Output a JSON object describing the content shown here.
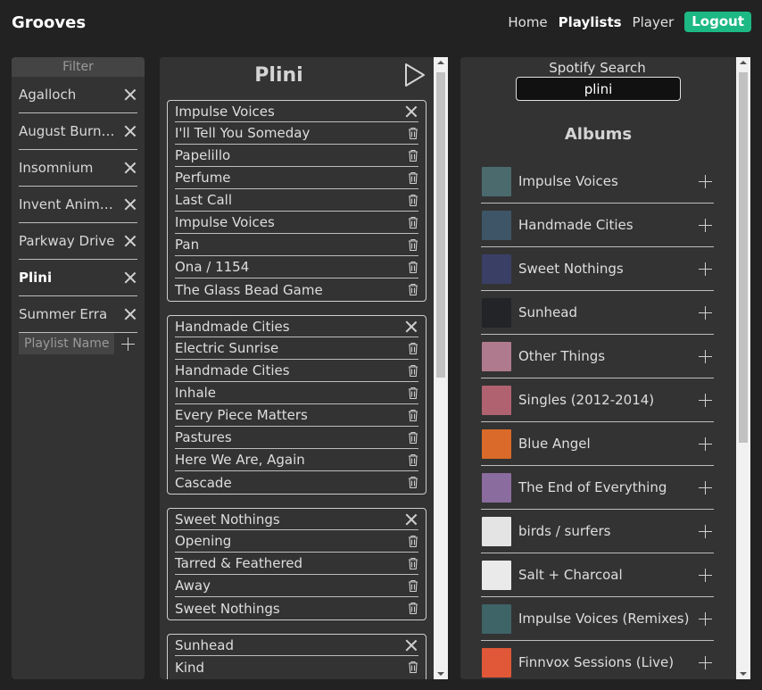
{
  "app": {
    "brand": "Grooves"
  },
  "nav": {
    "home": "Home",
    "playlists": "Playlists",
    "player": "Player",
    "logout": "Logout"
  },
  "filter": {
    "title": "Filter",
    "items": [
      {
        "label": "Agalloch"
      },
      {
        "label": "August Burns Red"
      },
      {
        "label": "Insomnium"
      },
      {
        "label": "Invent Animate"
      },
      {
        "label": "Parkway Drive"
      },
      {
        "label": "Plini"
      },
      {
        "label": "Summer Erra"
      }
    ],
    "active": "Plini",
    "new_playlist_placeholder": "Playlist Name"
  },
  "playlist": {
    "title": "Plini",
    "albums": [
      {
        "name": "Impulse Voices",
        "tracks": [
          "I'll Tell You Someday",
          "Papelillo",
          "Perfume",
          "Last Call",
          "Impulse Voices",
          "Pan",
          "Ona / 1154",
          "The Glass Bead Game"
        ]
      },
      {
        "name": "Handmade Cities",
        "tracks": [
          "Electric Sunrise",
          "Handmade Cities",
          "Inhale",
          "Every Piece Matters",
          "Pastures",
          "Here We Are, Again",
          "Cascade"
        ]
      },
      {
        "name": "Sweet Nothings",
        "tracks": [
          "Opening",
          "Tarred & Feathered",
          "Away",
          "Sweet Nothings"
        ]
      },
      {
        "name": "Sunhead",
        "tracks": [
          "Kind"
        ]
      }
    ]
  },
  "spotify": {
    "label": "Spotify Search",
    "query": "plini",
    "albums_title": "Albums",
    "albums": [
      {
        "name": "Impulse Voices",
        "color": "#4a6a6e"
      },
      {
        "name": "Handmade Cities",
        "color": "#3d5566"
      },
      {
        "name": "Sweet Nothings",
        "color": "#3a3f66"
      },
      {
        "name": "Sunhead",
        "color": "#222428"
      },
      {
        "name": "Other Things",
        "color": "#b07a8e"
      },
      {
        "name": "Singles (2012-2014)",
        "color": "#b06270"
      },
      {
        "name": "Blue Angel",
        "color": "#d96a2a"
      },
      {
        "name": "The End of Everything",
        "color": "#8a6c9e"
      },
      {
        "name": "birds / surfers",
        "color": "#e4e4e4"
      },
      {
        "name": "Salt + Charcoal",
        "color": "#eaeaea"
      },
      {
        "name": "Impulse Voices (Remixes)",
        "color": "#3e6468"
      },
      {
        "name": "Finnvox Sessions (Live)",
        "color": "#e05838"
      }
    ]
  }
}
